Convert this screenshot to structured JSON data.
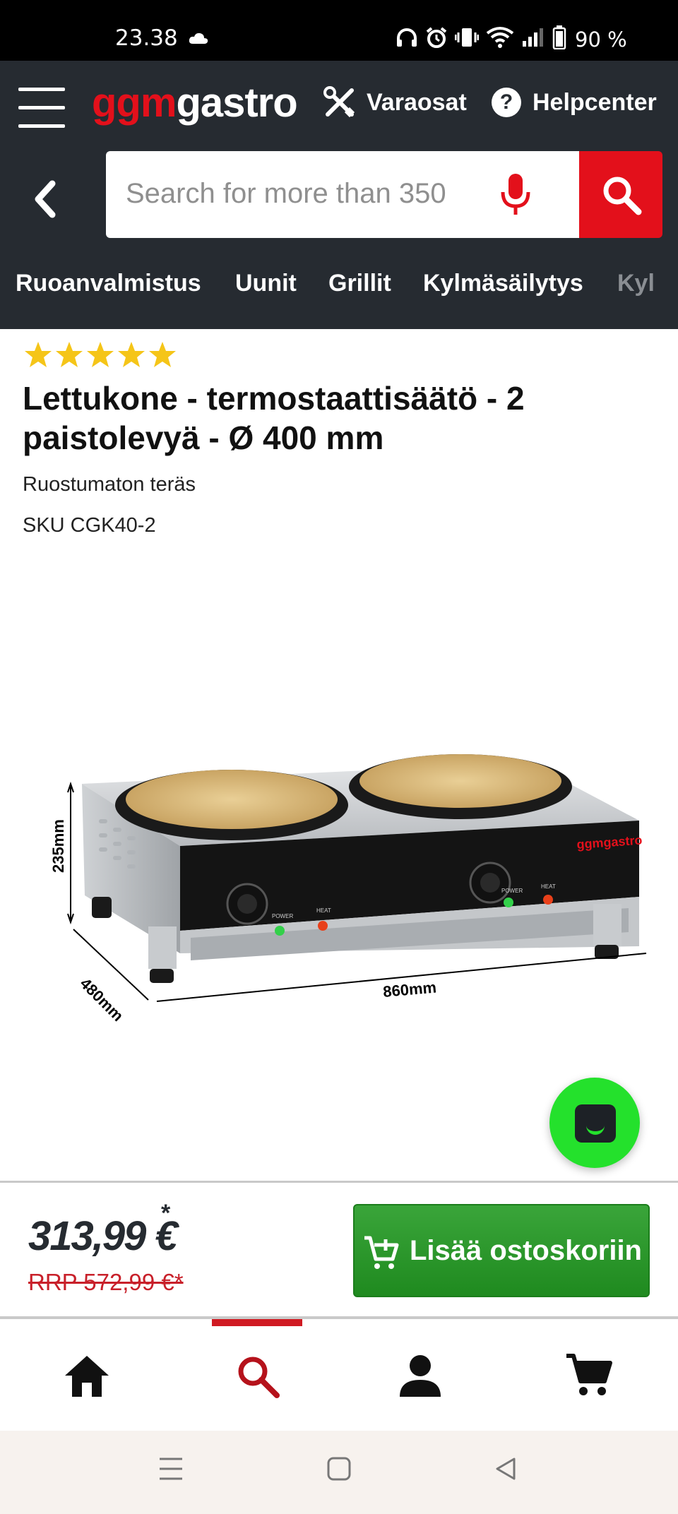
{
  "status_bar": {
    "time": "23.38",
    "battery": "90 %"
  },
  "header": {
    "logo_part1": "ggm",
    "logo_part2": "gastro",
    "varaosat": "Varaosat",
    "helpcenter": "Helpcenter",
    "help_glyph": "?"
  },
  "search": {
    "placeholder": "Search for more than 350"
  },
  "categories": [
    "Ruoanvalmistus",
    "Uunit",
    "Grillit",
    "Kylmäsäilytys",
    "Kyl"
  ],
  "product": {
    "rating_stars": 5,
    "title": "Lettukone - termostaattisäätö - 2 paistolevyä - Ø 400 mm",
    "material": "Ruostumaton teräs",
    "sku": "SKU CGK40-2",
    "image": {
      "dim_height": "235mm",
      "dim_depth": "480mm",
      "dim_width": "860mm",
      "brand_logo": "ggmgastro",
      "label_power": "POWER",
      "label_heat": "HEAT"
    }
  },
  "price_bar": {
    "price": "313,99 €",
    "price_asterisk": "*",
    "rrp": "RRP 572,99 €*",
    "add_to_cart": "Lisää ostoskoriin"
  },
  "bottom_nav": {
    "items": [
      "home-icon",
      "search-icon",
      "account-icon",
      "cart-icon"
    ],
    "active": "search-icon"
  },
  "colors": {
    "header_bg": "#262b31",
    "brand_red": "#e3101b",
    "cart_green": "#2f9a2f",
    "chat_green": "#24e12c",
    "star_yellow": "#f5c518"
  }
}
